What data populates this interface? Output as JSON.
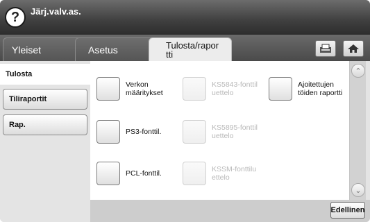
{
  "title_bar": {
    "help_icon": "question-mark-icon",
    "help_label": "?",
    "title": "Järj.valv.as."
  },
  "tabs": [
    {
      "label": "Yleiset"
    },
    {
      "label": "Asetus"
    },
    {
      "label_line1": "Tulosta/rapor",
      "label_line2": "tti",
      "active": true
    }
  ],
  "toolbar_icons": [
    "job-status-icon",
    "home-icon"
  ],
  "sidebar": {
    "items": [
      {
        "label": "Tulosta",
        "active": true
      },
      {
        "label": "Tiliraportit"
      },
      {
        "label": "Rap."
      }
    ]
  },
  "options": [
    {
      "label": "Verkon määritykset",
      "enabled": true
    },
    {
      "label": "KS5843-fonttiluettelo",
      "line1": "KS5843-fonttil",
      "line2": "uettelo",
      "enabled": false
    },
    {
      "label": "Ajoitettujen töiden raportti",
      "line1": "Ajoitettujen",
      "line2": "töiden raportti",
      "enabled": true
    },
    {
      "label": "PS3-fonttil.",
      "enabled": true
    },
    {
      "label": "KS5895-fonttiluettelo",
      "line1": "KS5895-fonttil",
      "line2": "uettelo",
      "enabled": false
    },
    {
      "label": "PCL-fonttil.",
      "enabled": true
    },
    {
      "label": "KSSM-fonttiluettelo",
      "line1": "KSSM-fonttilu",
      "line2": "ettelo",
      "enabled": false
    }
  ],
  "option_labels": {
    "verkon_line1": "Verkon",
    "verkon_line2": "määritykset"
  },
  "scroll": {
    "up_icon": "chevron-up-icon",
    "down_icon": "chevron-down-icon",
    "up": "⌃",
    "down": "⌄"
  },
  "footer": {
    "back_label": "Edellinen"
  },
  "colors": {
    "title_bar": "#3f3f3f",
    "content_bg": "#ffffff",
    "panel_bg": "#e4e4e4"
  }
}
